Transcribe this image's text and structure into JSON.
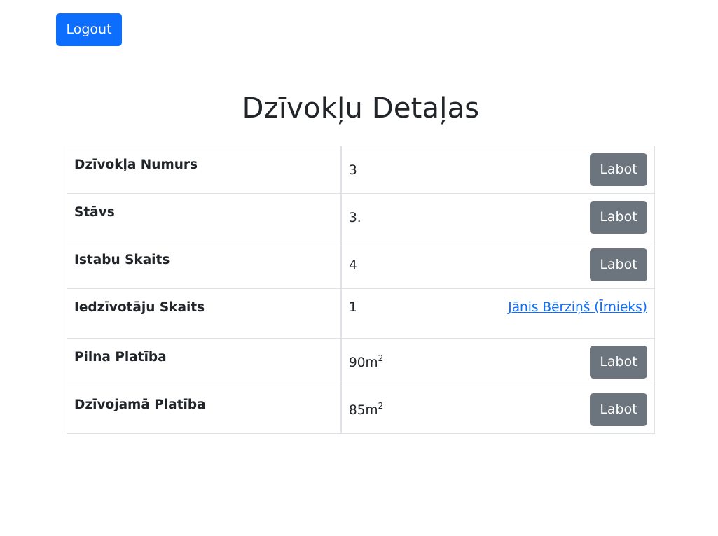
{
  "header": {
    "logout_label": "Logout"
  },
  "page": {
    "title": "Dzīvokļu Detaļas"
  },
  "rows": [
    {
      "label": "Dzīvokļa Numurs",
      "value": "3",
      "unit": "",
      "action": "Labot"
    },
    {
      "label": "Stāvs",
      "value": "3.",
      "unit": "",
      "action": "Labot"
    },
    {
      "label": "Istabu Skaits",
      "value": "4",
      "unit": "",
      "action": "Labot"
    },
    {
      "label": "Iedzīvotāju Skaits",
      "value": "1",
      "unit": "",
      "link": "Jānis Bērziņš (Īrnieks)"
    },
    {
      "label": "Pilna Platība",
      "value": "90m",
      "unit": "2",
      "action": "Labot"
    },
    {
      "label": "Dzīvojamā Platība",
      "value": "85m",
      "unit": "2",
      "action": "Labot"
    }
  ],
  "colors": {
    "primary": "#0d6efd",
    "secondary": "#6c757d",
    "border": "#dee2e6",
    "text": "#212529"
  }
}
